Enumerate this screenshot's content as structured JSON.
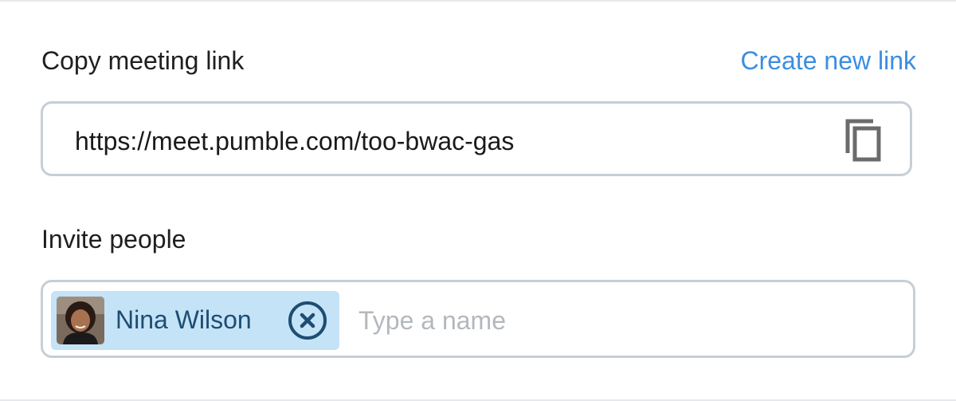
{
  "copy_link": {
    "label": "Copy meeting link",
    "create_new_label": "Create new link",
    "url": "https://meet.pumble.com/too-bwac-gas",
    "copy_icon": "copy-icon"
  },
  "invite": {
    "label": "Invite people",
    "chips": [
      {
        "name": "Nina Wilson",
        "avatar": "user-photo",
        "remove_icon": "close-circle-icon"
      }
    ],
    "input_placeholder": "Type a name",
    "input_value": ""
  },
  "colors": {
    "link": "#3b8ee0",
    "chip_background": "#c5e3f7",
    "chip_text": "#1e4d73",
    "border": "#c6ced6",
    "placeholder": "#b3b8bd"
  }
}
